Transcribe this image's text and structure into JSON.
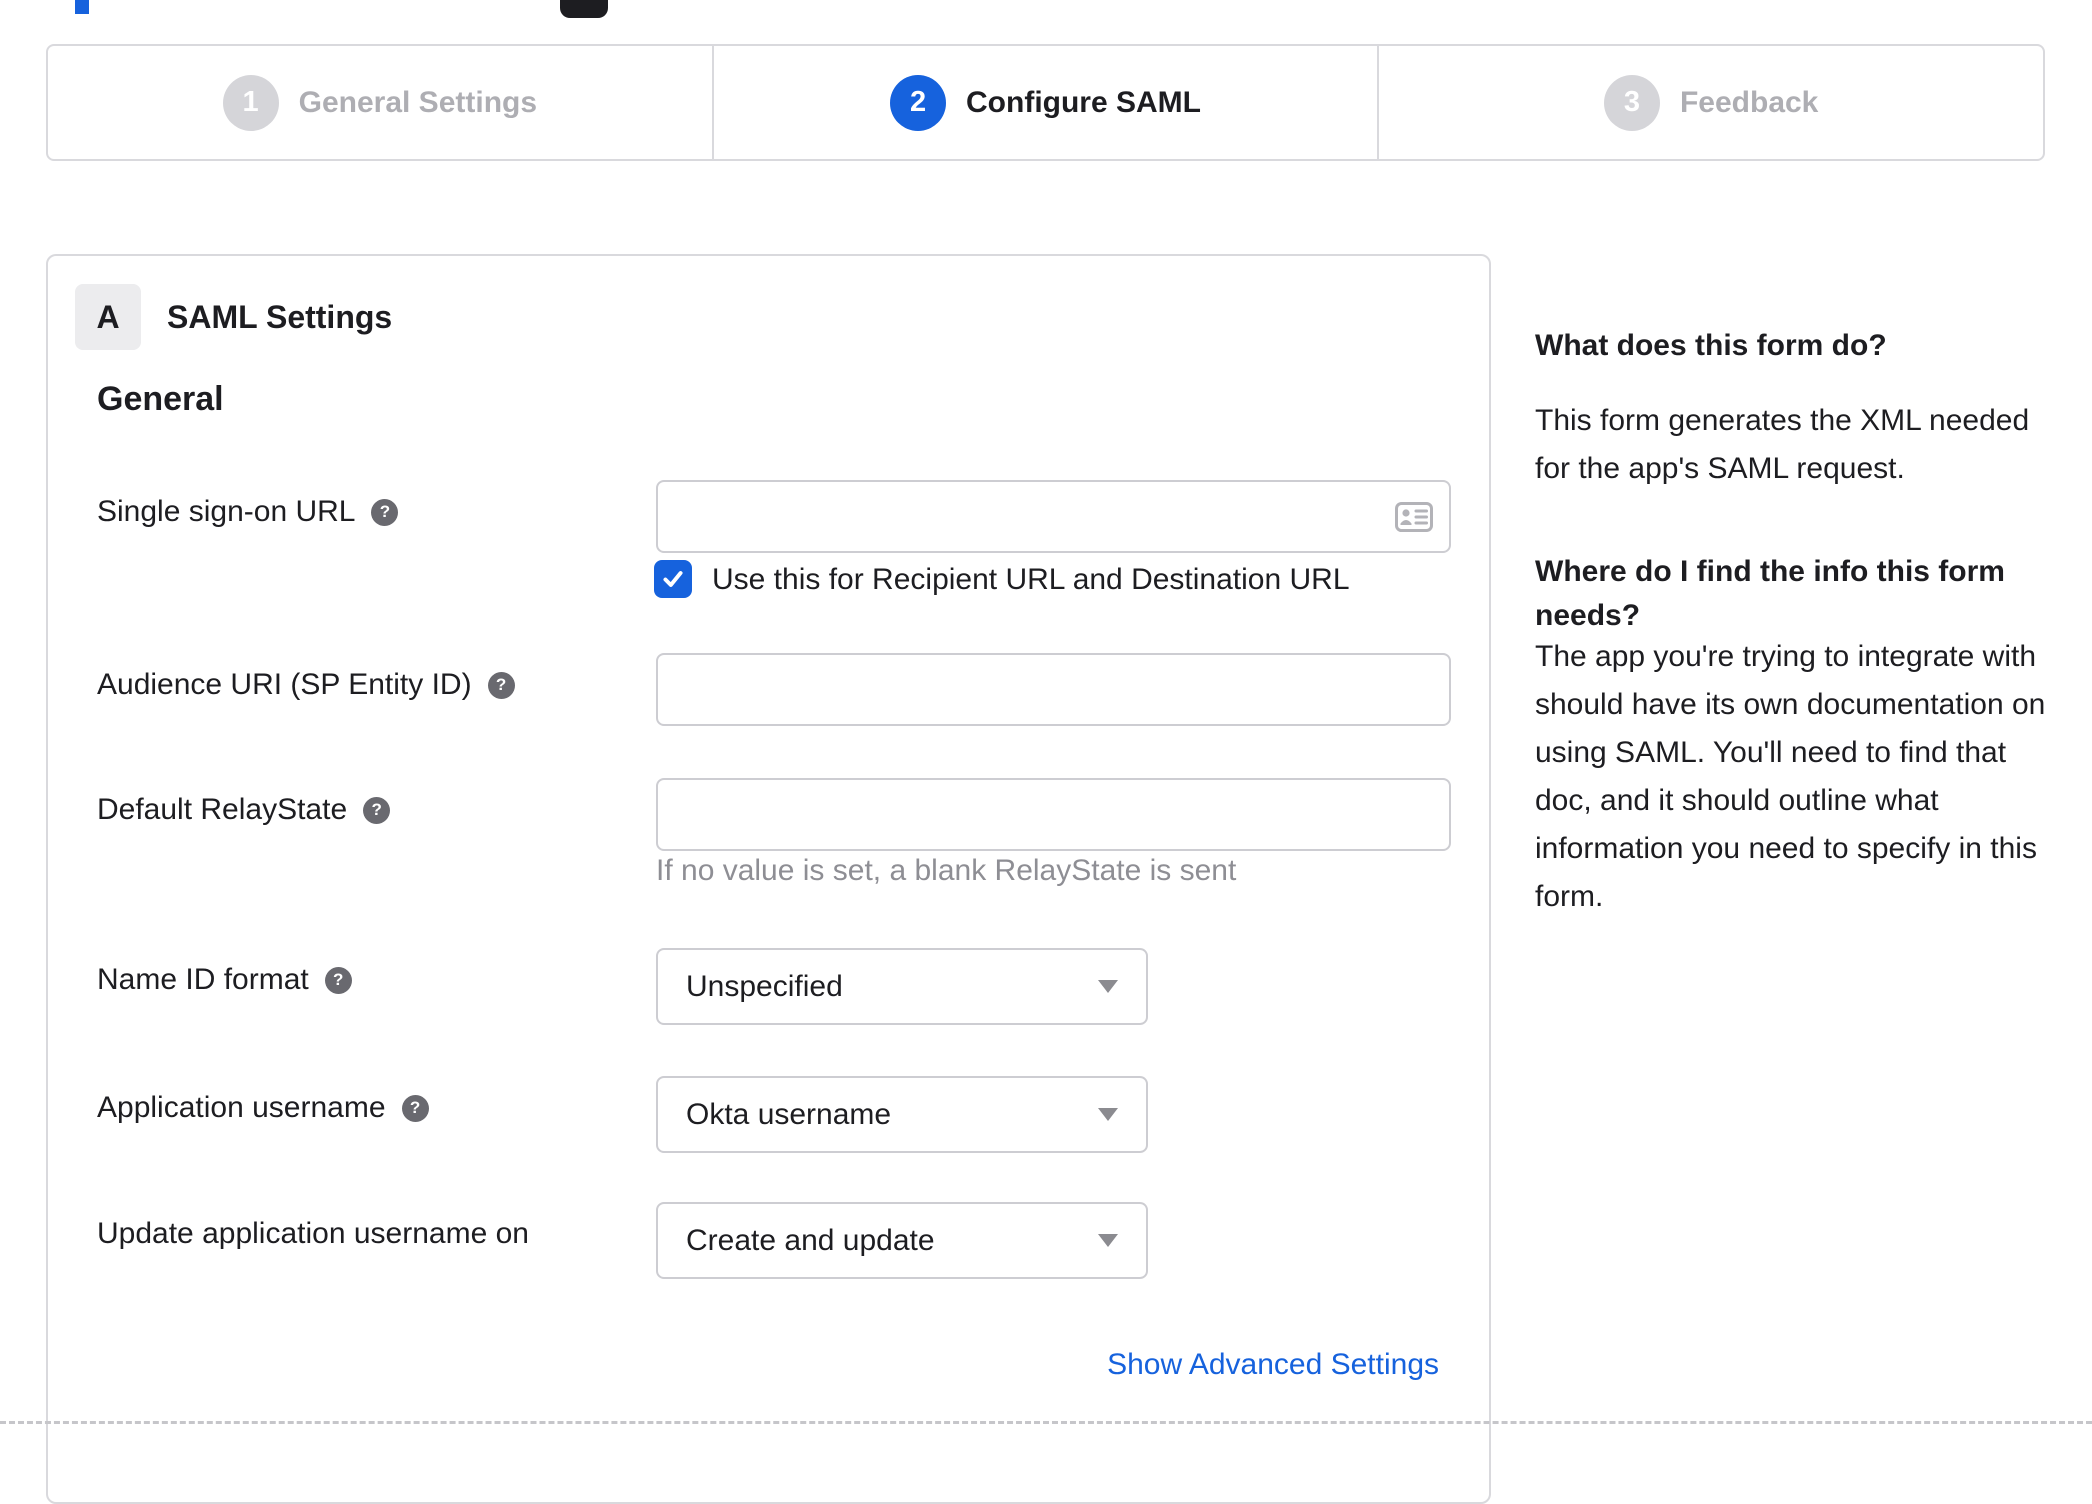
{
  "colors": {
    "accent_blue": "#1662dd",
    "text": "#1d1d21",
    "inactive_gray": "#aeaeb3",
    "border_gray": "#d9d9dd",
    "hint_gray": "#8e8e94"
  },
  "stepper": {
    "steps": [
      {
        "number": "1",
        "label": "General Settings",
        "state": "inactive"
      },
      {
        "number": "2",
        "label": "Configure SAML",
        "state": "active"
      },
      {
        "number": "3",
        "label": "Feedback",
        "state": "inactive"
      }
    ]
  },
  "form": {
    "section_badge": "A",
    "section_title": "SAML Settings",
    "group_heading": "General",
    "sso": {
      "label": "Single sign-on URL",
      "value": "",
      "checkbox_label": "Use this for Recipient URL and Destination URL",
      "checked": true
    },
    "audience": {
      "label": "Audience URI (SP Entity ID)",
      "value": ""
    },
    "relaystate": {
      "label": "Default RelayState",
      "value": "",
      "hint": "If no value is set, a blank RelayState is sent"
    },
    "nameid": {
      "label": "Name ID format",
      "value": "Unspecified"
    },
    "appusername": {
      "label": "Application username",
      "value": "Okta username"
    },
    "updateusername": {
      "label": "Update application username on",
      "value": "Create and update"
    },
    "advanced_link_label": "Show Advanced Settings"
  },
  "help": {
    "q1_title": "What does this form do?",
    "q1_body": "This form generates the XML needed\nfor the app's SAML request.",
    "q2_title": "Where do I find the info this form\nneeds?",
    "q2_body": "The app you're trying to integrate with\nshould have its own documentation on\nusing SAML. You'll need to find that\ndoc, and it should outline what\ninformation you need to specify in this\nform."
  }
}
